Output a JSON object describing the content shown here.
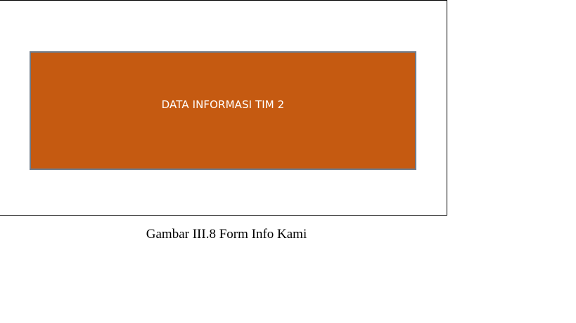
{
  "panel": {
    "label": "DATA INFORMASI TIM 2",
    "fill_color": "#c55a11",
    "border_color": "#6f7b8a"
  },
  "caption": {
    "text": "Gambar III.8 Form Info Kami"
  }
}
